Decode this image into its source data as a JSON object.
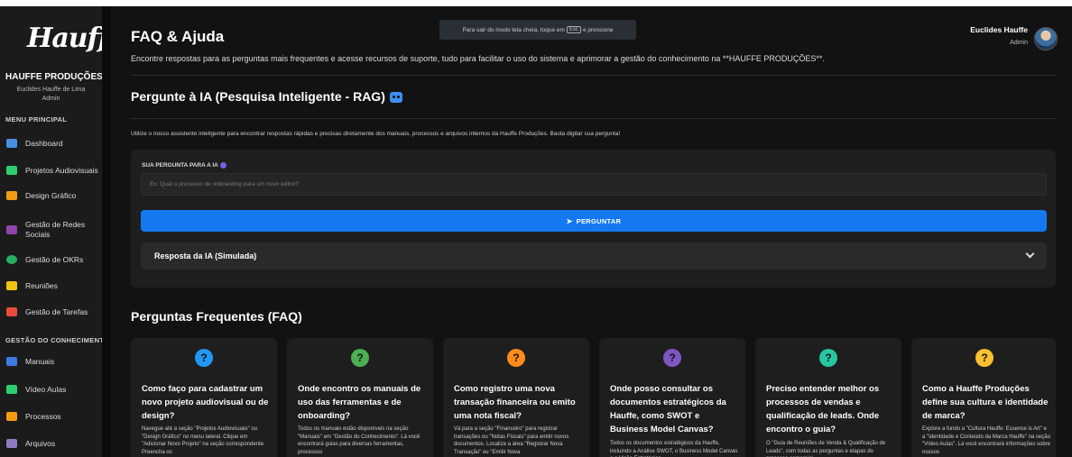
{
  "sidebar": {
    "logo": "Hauffe",
    "company": "HAUFFE PRODUÇÕES",
    "user_name": "Euclides Hauffe de Lima",
    "user_role": "Admin",
    "menu_title": "MENU PRINCIPAL",
    "items": [
      {
        "label": "Dashboard",
        "color": "#4a90e2"
      },
      {
        "label": "Projetos Audiovisuais",
        "color": "#2ecc71"
      },
      {
        "label": "Design Gráfico",
        "color": "#f39c12"
      },
      {
        "label": "Gestão de Redes Sociais",
        "color": "#8e44ad"
      },
      {
        "label": "Gestão de OKRs",
        "color": "#27ae60"
      },
      {
        "label": "Reuniões",
        "color": "#f1c40f"
      },
      {
        "label": "Gestão de Tarefas",
        "color": "#e74c3c"
      }
    ],
    "knowledge_title": "GESTÃO DO CONHECIMENTO",
    "knowledge_items": [
      {
        "label": "Manuais",
        "color": "#3d7be0"
      },
      {
        "label": "Vídeo Aulas",
        "color": "#2ecc71"
      },
      {
        "label": "Processos",
        "color": "#f39c12"
      },
      {
        "label": "Arquivos",
        "color": "#8e7cc3"
      }
    ]
  },
  "header": {
    "title": "FAQ & Ajuda",
    "subtitle": "Encontre respostas para as perguntas mais frequentes e acesse recursos de suporte, tudo para facilitar o uso do sistema e aprimorar a gestão do conhecimento na **HAUFFE PRODUÇÕES**.",
    "fullscreen_hint_before": "Para sair do modo tela cheia, toque em",
    "fullscreen_hint_key": "Esc",
    "fullscreen_hint_after": "e pressione",
    "user_name": "Euclides Hauffe",
    "user_role": "Admin"
  },
  "ia": {
    "title": "Pergunte à IA (Pesquisa Inteligente - RAG)",
    "description": "Utilize o nosso assistente inteligente para encontrar respostas rápidas e precisas diretamente dos manuais, processos e arquivos internos da Hauffe Produções. Basta digitar sua pergunta!",
    "question_label": "SUA PERGUNTA PARA A IA",
    "question_placeholder": "Ex: Qual o processo de onboarding para um novo editor?",
    "ask_label": "PERGUNTAR",
    "answer_label": "Resposta da IA (Simulada)"
  },
  "faq": {
    "title": "Perguntas Frequentes (FAQ)",
    "cards": [
      {
        "color": "#2196f3",
        "question": "Como faço para cadastrar um novo projeto audiovisual ou de design?",
        "answer": "Navegue até a seção \"Projetos Audiovisuais\" ou \"Design Gráfico\" no menu lateral. Clique em \"Adicionar Novo Projeto\" na seção correspondente. Preencha os"
      },
      {
        "color": "#4caf50",
        "question": "Onde encontro os manuais de uso das ferramentas e de onboarding?",
        "answer": "Todos os manuais estão disponíveis na seção \"Manuais\" em \"Gestão do Conhecimento\". Lá você encontrará guias para diversas ferramentas, processos"
      },
      {
        "color": "#ff8c1a",
        "question": "Como registro uma nova transação financeira ou emito uma nota fiscal?",
        "answer": "Vá para a seção \"Financeiro\" para registrar transações ou \"Notas Fiscais\" para emitir novos documentos. Localize a área \"Registrar Nova Transação\" ou \"Emitir Nova"
      },
      {
        "color": "#7e57c2",
        "question": "Onde posso consultar os documentos estratégicos da Hauffe, como SWOT e Business Model Canvas?",
        "answer": "Todos os documentos estratégicos da Hauffe, incluindo a Análise SWOT, o Business Model Canvas e a Visão Estratégica"
      },
      {
        "color": "#26c6a0",
        "question": "Preciso entender melhor os processos de vendas e qualificação de leads. Onde encontro o guia?",
        "answer": "O \"Guia de Reuniões de Venda & Qualificação de Leads\", com todas as perguntas e etapas do processo comercial"
      },
      {
        "color": "#fbc02d",
        "question": "Como a Hauffe Produções define sua cultura e identidade de marca?",
        "answer": "Explore a fundo a \"Cultura Hauffe: Essence is Art\" e a \"Identidade e Conteúdo da Marca Hauffe\" na seção \"Vídeo Aulas\". Lá você encontrará informações sobre nossos"
      }
    ]
  }
}
